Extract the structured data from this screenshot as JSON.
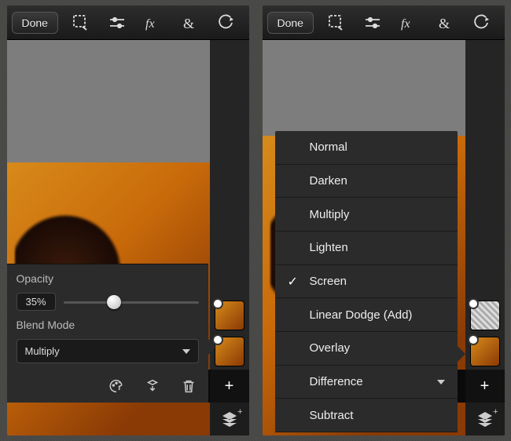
{
  "toolbar": {
    "done_label": "Done"
  },
  "left_panel": {
    "opacity_label": "Opacity",
    "opacity_value": "35%",
    "opacity_fraction": 0.35,
    "blend_mode_label": "Blend Mode",
    "blend_mode_value": "Multiply"
  },
  "blend_modes": [
    {
      "label": "Normal",
      "selected": false
    },
    {
      "label": "Darken",
      "selected": false
    },
    {
      "label": "Multiply",
      "selected": false
    },
    {
      "label": "Lighten",
      "selected": false
    },
    {
      "label": "Screen",
      "selected": true
    },
    {
      "label": "Linear Dodge (Add)",
      "selected": false
    },
    {
      "label": "Overlay",
      "selected": false
    },
    {
      "label": "Difference",
      "selected": false,
      "has_caret": true
    },
    {
      "label": "Subtract",
      "selected": false
    }
  ]
}
